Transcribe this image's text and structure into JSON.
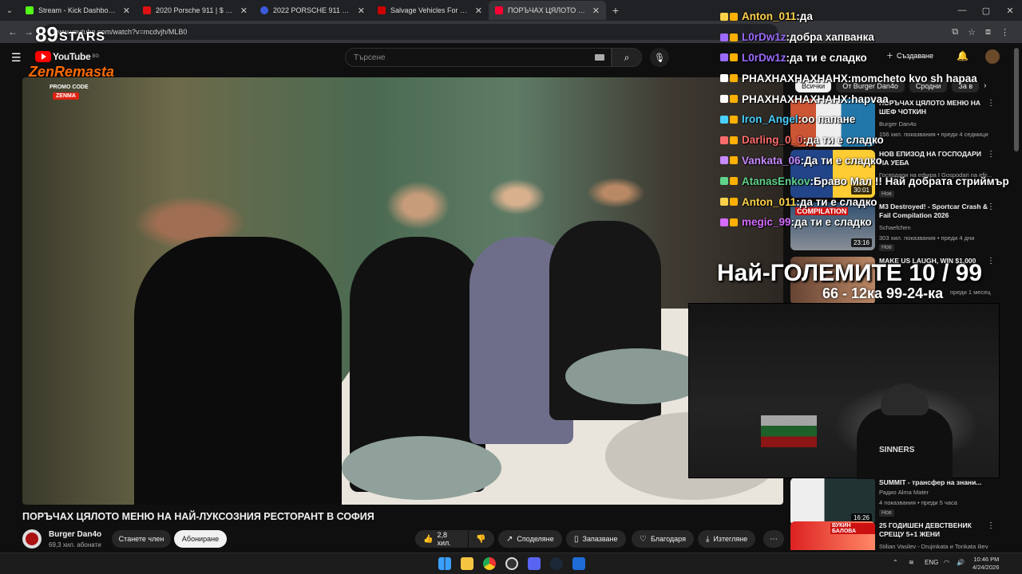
{
  "browser": {
    "tabs": [
      {
        "title": "Stream - Kick Dashboard",
        "color": "#53fc18"
      },
      {
        "title": "2020 Porsche 911 | $ 143,898 | E",
        "color": "#d11"
      },
      {
        "title": "2022 PORSCHE 911 TURBO | Er",
        "color": "#3b5bdb"
      },
      {
        "title": "Salvage Vehicles For Sale | IAA",
        "color": "#c00"
      },
      {
        "title": "ПОРЪЧАХ ЦЯЛОТО МЕНЮ НА",
        "color": "#ff0033"
      }
    ],
    "url": "www.youtube.com/watch?v=mcdvjh/MLB0"
  },
  "youtube": {
    "logo_text": "YouTube",
    "region": "BG",
    "search_placeholder": "Търсене",
    "create_label": "Създаване"
  },
  "overlay": {
    "logo_number": "89",
    "logo_stars": "STARS",
    "logo_brand": "ZenRemasta",
    "promo_label": "PROMO CODE",
    "promo_code": "ZENMA",
    "big_text": "Най-ГОЛЕМИТЕ 10 / 99",
    "big_sub": "66 - 12ка 99-24-ка",
    "cam_shirt": "SINNERS"
  },
  "chat": [
    {
      "user": "Anton_011",
      "msg": "да",
      "color": "#ffd24a"
    },
    {
      "user": "L0rDw1z",
      "msg": "добра хапванка",
      "color": "#9b6bff"
    },
    {
      "user": "L0rDw1z",
      "msg": "да ти е сладко",
      "color": "#9b6bff"
    },
    {
      "user": "PHAXHAXHAXHAHX",
      "msg": "momcheto kvo sh hapaa",
      "color": "#ffffff"
    },
    {
      "user": "PHAXHAXHAXHAHX",
      "msg": "hapvaa",
      "color": "#ffffff"
    },
    {
      "user": "Iron_Angel",
      "msg": "оо папане",
      "color": "#4ad0ff"
    },
    {
      "user": "Darling_0_0",
      "msg": "да ти е сладко",
      "color": "#ff6b6b"
    },
    {
      "user": "Vankata_06",
      "msg": "Да ти е сладко",
      "color": "#c78bff"
    },
    {
      "user": "AtanasEnkov",
      "msg": "Браво Мал !! Най добрата стриймър",
      "color": "#5fd38a"
    },
    {
      "user": "Anton_011",
      "msg": "да ти е сладко",
      "color": "#ffd24a"
    },
    {
      "user": "megic_99",
      "msg": "да ти е сладко",
      "color": "#d66bff"
    }
  ],
  "related": {
    "chips": [
      "Всички",
      "От Burger Dan4o",
      "Сродни",
      "За в"
    ],
    "items": [
      {
        "title": "ПОРЪЧАХ ЦЯЛОТО МЕНЮ НА ШЕФ ЧОТКИН",
        "channel": "Burger Dan4o",
        "meta": "156 хил. показвания • преди 4 седмици",
        "duration": "",
        "badge": ""
      },
      {
        "title": "НОВ ЕПИЗОД НА ГОСПОДАРИ НА УЕБА",
        "channel": "Господари на ефира I Gospodari na efir...",
        "meta": "",
        "duration": "30:01",
        "badge": "Нов"
      },
      {
        "title": "M3 Destroyed! - Sportcar Crash & Fail Compilation 2026",
        "channel": "Schaefchen",
        "meta": "303 хил. показвания • преди 4 дни",
        "duration": "23:16",
        "badge": "Нов",
        "thumb_text": "COMPILATION"
      },
      {
        "title": "MAKE US LAUGH, WIN $1,000",
        "channel": "",
        "meta": "преди 1 месец",
        "duration": "",
        "badge": ""
      },
      {
        "title": "SUMMIT - трансфер на знани...",
        "channel": "Радио Alma Mater",
        "meta": "4 показвания • преди 5 часа",
        "duration": "16:26",
        "badge": "Нов"
      },
      {
        "title": "25 ГОДИШЕН ДЕВСТВЕНИК СРЕЩУ 5+1 ЖЕНИ",
        "channel": "Stilian Vasilev - Drujinkata и Tonkata Iliev",
        "meta": "",
        "duration": "",
        "badge": "",
        "thumb_text": "ВУКИН БАЛОВА"
      }
    ]
  },
  "video": {
    "title": "ПОРЪЧАХ ЦЯЛОТО МЕНЮ НА НАЙ-ЛУКСОЗНИЯ РЕСТОРАНТ В СОФИЯ",
    "channel": "Burger Dan4o",
    "subscribers": "69,3 хил. абонати",
    "join_label": "Станете член",
    "subscribe_label": "Абониране",
    "likes": "2,8 хил.",
    "share_label": "Споделяне",
    "save_label": "Запазване",
    "thanks_label": "Благодаря",
    "download_label": "Изтегляне"
  },
  "taskbar": {
    "lang": "ENG",
    "time": "10:46 PM",
    "date": "4/24/2026"
  }
}
